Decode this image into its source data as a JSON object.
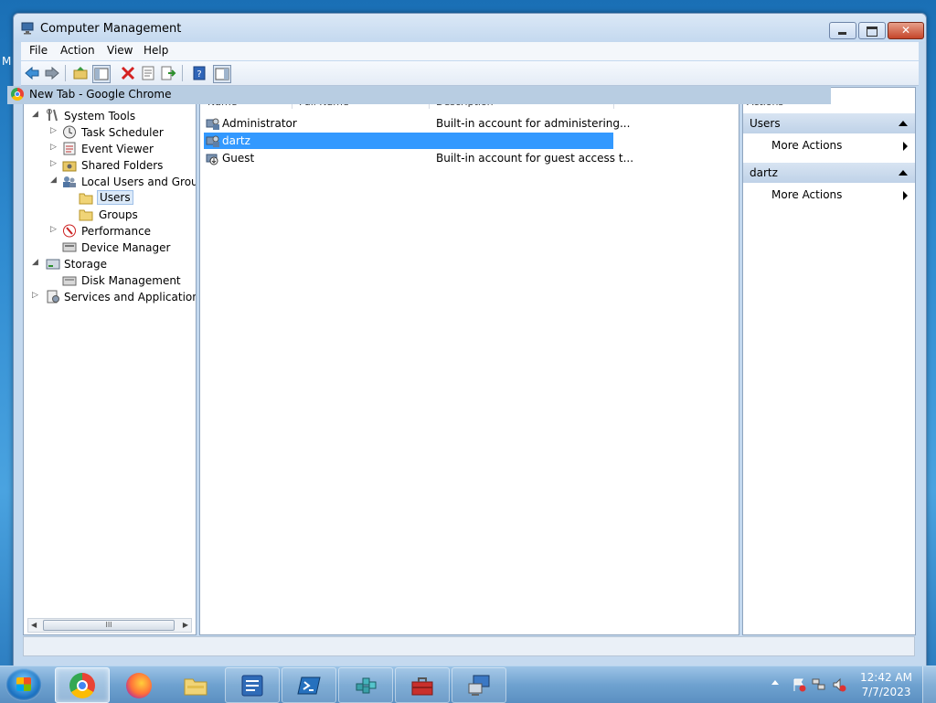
{
  "desktop": {
    "edge_letter": "M"
  },
  "window": {
    "title": "Computer Management",
    "close_glyph": "✕"
  },
  "menu": {
    "file": "File",
    "action": "Action",
    "view": "View",
    "help": "Help"
  },
  "toolbar": {
    "icons": [
      "back-arrow-icon",
      "forward-arrow-icon",
      "up-folder-icon",
      "show-hide-tree-icon",
      "delete-icon",
      "properties-icon",
      "export-list-icon",
      "help-icon",
      "show-hide-action-pane-icon"
    ]
  },
  "overlay": {
    "chrome_tab_title": "New Tab - Google Chrome"
  },
  "tree": {
    "items": [
      {
        "label": "System Tools",
        "expander": "◢"
      },
      {
        "label": "Task Scheduler",
        "expander": "▷"
      },
      {
        "label": "Event Viewer",
        "expander": "▷"
      },
      {
        "label": "Shared Folders",
        "expander": "▷"
      },
      {
        "label": "Local Users and Groups",
        "expander": "◢"
      },
      {
        "label": "Users"
      },
      {
        "label": "Groups"
      },
      {
        "label": "Performance",
        "expander": "▷"
      },
      {
        "label": "Device Manager"
      },
      {
        "label": "Storage",
        "expander": "◢"
      },
      {
        "label": "Disk Management"
      },
      {
        "label": "Services and Applications",
        "expander": "▷"
      }
    ],
    "scroll_grip": "III"
  },
  "list": {
    "columns": {
      "name": "Name",
      "full_name": "Full Name",
      "description": "Description"
    },
    "rows": [
      {
        "name": "Administrator",
        "description": "Built-in account for administering..."
      },
      {
        "name": "dartz",
        "description": ""
      },
      {
        "name": "Guest",
        "description": "Built-in account for guest access t..."
      }
    ]
  },
  "actions": {
    "header": "Actions",
    "sections": [
      {
        "title": "Users",
        "item": "More Actions"
      },
      {
        "title": "dartz",
        "item": "More Actions"
      }
    ]
  },
  "taskbar": {
    "apps": [
      "chrome-icon",
      "firefox-icon",
      "file-explorer-icon",
      "computer-management-icon",
      "powershell-icon",
      "registry-editor-icon",
      "toolbox-icon",
      "remote-desktop-icon"
    ],
    "active_app": "chrome-icon"
  },
  "tray": {
    "time": "12:42 AM",
    "date": "7/7/2023"
  },
  "colors": {
    "selection": "#3399ff",
    "taskbar": "#6fa2d0",
    "window_frame": "#c4d9ef"
  }
}
